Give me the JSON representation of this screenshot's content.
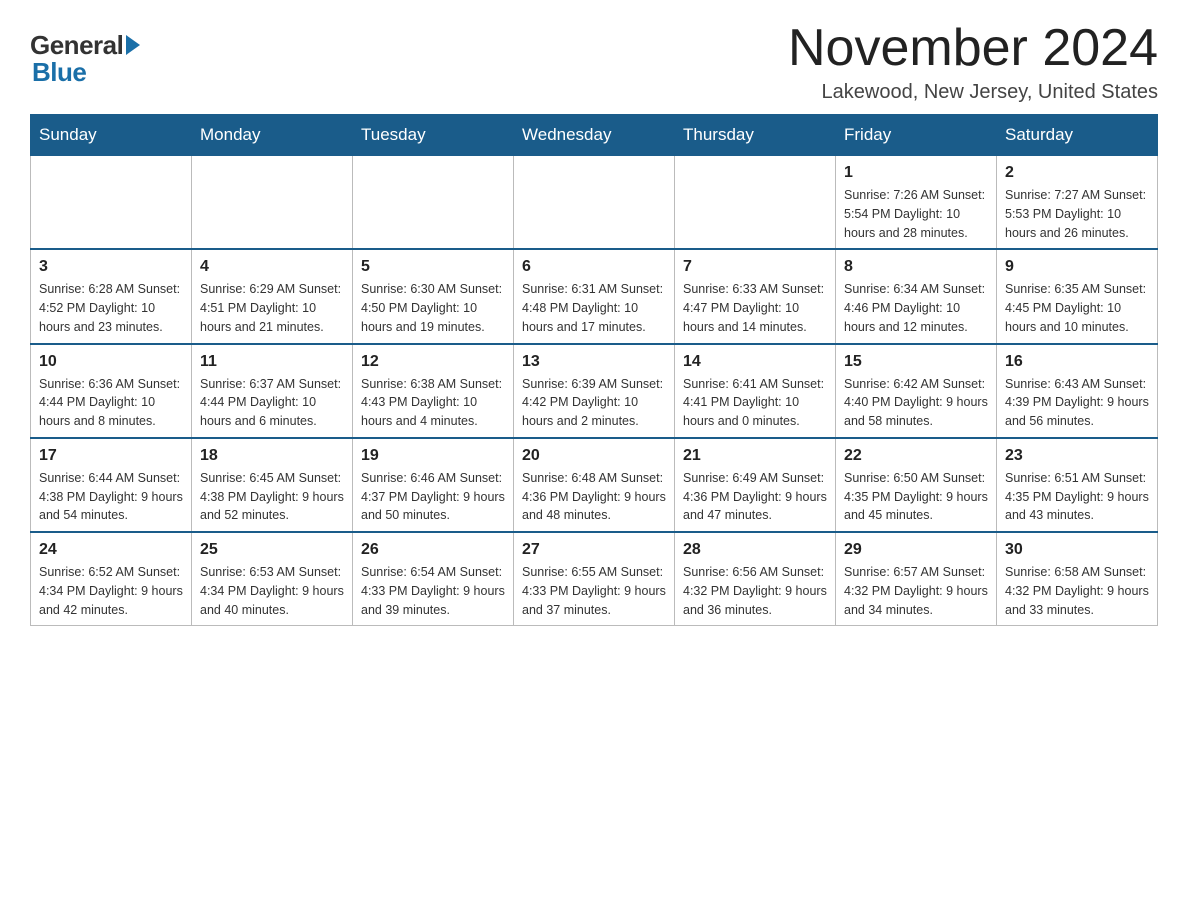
{
  "header": {
    "logo_general": "General",
    "logo_blue": "Blue",
    "month_title": "November 2024",
    "location": "Lakewood, New Jersey, United States"
  },
  "days_of_week": [
    "Sunday",
    "Monday",
    "Tuesday",
    "Wednesday",
    "Thursday",
    "Friday",
    "Saturday"
  ],
  "weeks": [
    [
      {
        "day": "",
        "info": "",
        "empty": true
      },
      {
        "day": "",
        "info": "",
        "empty": true
      },
      {
        "day": "",
        "info": "",
        "empty": true
      },
      {
        "day": "",
        "info": "",
        "empty": true
      },
      {
        "day": "",
        "info": "",
        "empty": true
      },
      {
        "day": "1",
        "info": "Sunrise: 7:26 AM\nSunset: 5:54 PM\nDaylight: 10 hours and 28 minutes."
      },
      {
        "day": "2",
        "info": "Sunrise: 7:27 AM\nSunset: 5:53 PM\nDaylight: 10 hours and 26 minutes."
      }
    ],
    [
      {
        "day": "3",
        "info": "Sunrise: 6:28 AM\nSunset: 4:52 PM\nDaylight: 10 hours and 23 minutes."
      },
      {
        "day": "4",
        "info": "Sunrise: 6:29 AM\nSunset: 4:51 PM\nDaylight: 10 hours and 21 minutes."
      },
      {
        "day": "5",
        "info": "Sunrise: 6:30 AM\nSunset: 4:50 PM\nDaylight: 10 hours and 19 minutes."
      },
      {
        "day": "6",
        "info": "Sunrise: 6:31 AM\nSunset: 4:48 PM\nDaylight: 10 hours and 17 minutes."
      },
      {
        "day": "7",
        "info": "Sunrise: 6:33 AM\nSunset: 4:47 PM\nDaylight: 10 hours and 14 minutes."
      },
      {
        "day": "8",
        "info": "Sunrise: 6:34 AM\nSunset: 4:46 PM\nDaylight: 10 hours and 12 minutes."
      },
      {
        "day": "9",
        "info": "Sunrise: 6:35 AM\nSunset: 4:45 PM\nDaylight: 10 hours and 10 minutes."
      }
    ],
    [
      {
        "day": "10",
        "info": "Sunrise: 6:36 AM\nSunset: 4:44 PM\nDaylight: 10 hours and 8 minutes."
      },
      {
        "day": "11",
        "info": "Sunrise: 6:37 AM\nSunset: 4:44 PM\nDaylight: 10 hours and 6 minutes."
      },
      {
        "day": "12",
        "info": "Sunrise: 6:38 AM\nSunset: 4:43 PM\nDaylight: 10 hours and 4 minutes."
      },
      {
        "day": "13",
        "info": "Sunrise: 6:39 AM\nSunset: 4:42 PM\nDaylight: 10 hours and 2 minutes."
      },
      {
        "day": "14",
        "info": "Sunrise: 6:41 AM\nSunset: 4:41 PM\nDaylight: 10 hours and 0 minutes."
      },
      {
        "day": "15",
        "info": "Sunrise: 6:42 AM\nSunset: 4:40 PM\nDaylight: 9 hours and 58 minutes."
      },
      {
        "day": "16",
        "info": "Sunrise: 6:43 AM\nSunset: 4:39 PM\nDaylight: 9 hours and 56 minutes."
      }
    ],
    [
      {
        "day": "17",
        "info": "Sunrise: 6:44 AM\nSunset: 4:38 PM\nDaylight: 9 hours and 54 minutes."
      },
      {
        "day": "18",
        "info": "Sunrise: 6:45 AM\nSunset: 4:38 PM\nDaylight: 9 hours and 52 minutes."
      },
      {
        "day": "19",
        "info": "Sunrise: 6:46 AM\nSunset: 4:37 PM\nDaylight: 9 hours and 50 minutes."
      },
      {
        "day": "20",
        "info": "Sunrise: 6:48 AM\nSunset: 4:36 PM\nDaylight: 9 hours and 48 minutes."
      },
      {
        "day": "21",
        "info": "Sunrise: 6:49 AM\nSunset: 4:36 PM\nDaylight: 9 hours and 47 minutes."
      },
      {
        "day": "22",
        "info": "Sunrise: 6:50 AM\nSunset: 4:35 PM\nDaylight: 9 hours and 45 minutes."
      },
      {
        "day": "23",
        "info": "Sunrise: 6:51 AM\nSunset: 4:35 PM\nDaylight: 9 hours and 43 minutes."
      }
    ],
    [
      {
        "day": "24",
        "info": "Sunrise: 6:52 AM\nSunset: 4:34 PM\nDaylight: 9 hours and 42 minutes."
      },
      {
        "day": "25",
        "info": "Sunrise: 6:53 AM\nSunset: 4:34 PM\nDaylight: 9 hours and 40 minutes."
      },
      {
        "day": "26",
        "info": "Sunrise: 6:54 AM\nSunset: 4:33 PM\nDaylight: 9 hours and 39 minutes."
      },
      {
        "day": "27",
        "info": "Sunrise: 6:55 AM\nSunset: 4:33 PM\nDaylight: 9 hours and 37 minutes."
      },
      {
        "day": "28",
        "info": "Sunrise: 6:56 AM\nSunset: 4:32 PM\nDaylight: 9 hours and 36 minutes."
      },
      {
        "day": "29",
        "info": "Sunrise: 6:57 AM\nSunset: 4:32 PM\nDaylight: 9 hours and 34 minutes."
      },
      {
        "day": "30",
        "info": "Sunrise: 6:58 AM\nSunset: 4:32 PM\nDaylight: 9 hours and 33 minutes."
      }
    ]
  ]
}
